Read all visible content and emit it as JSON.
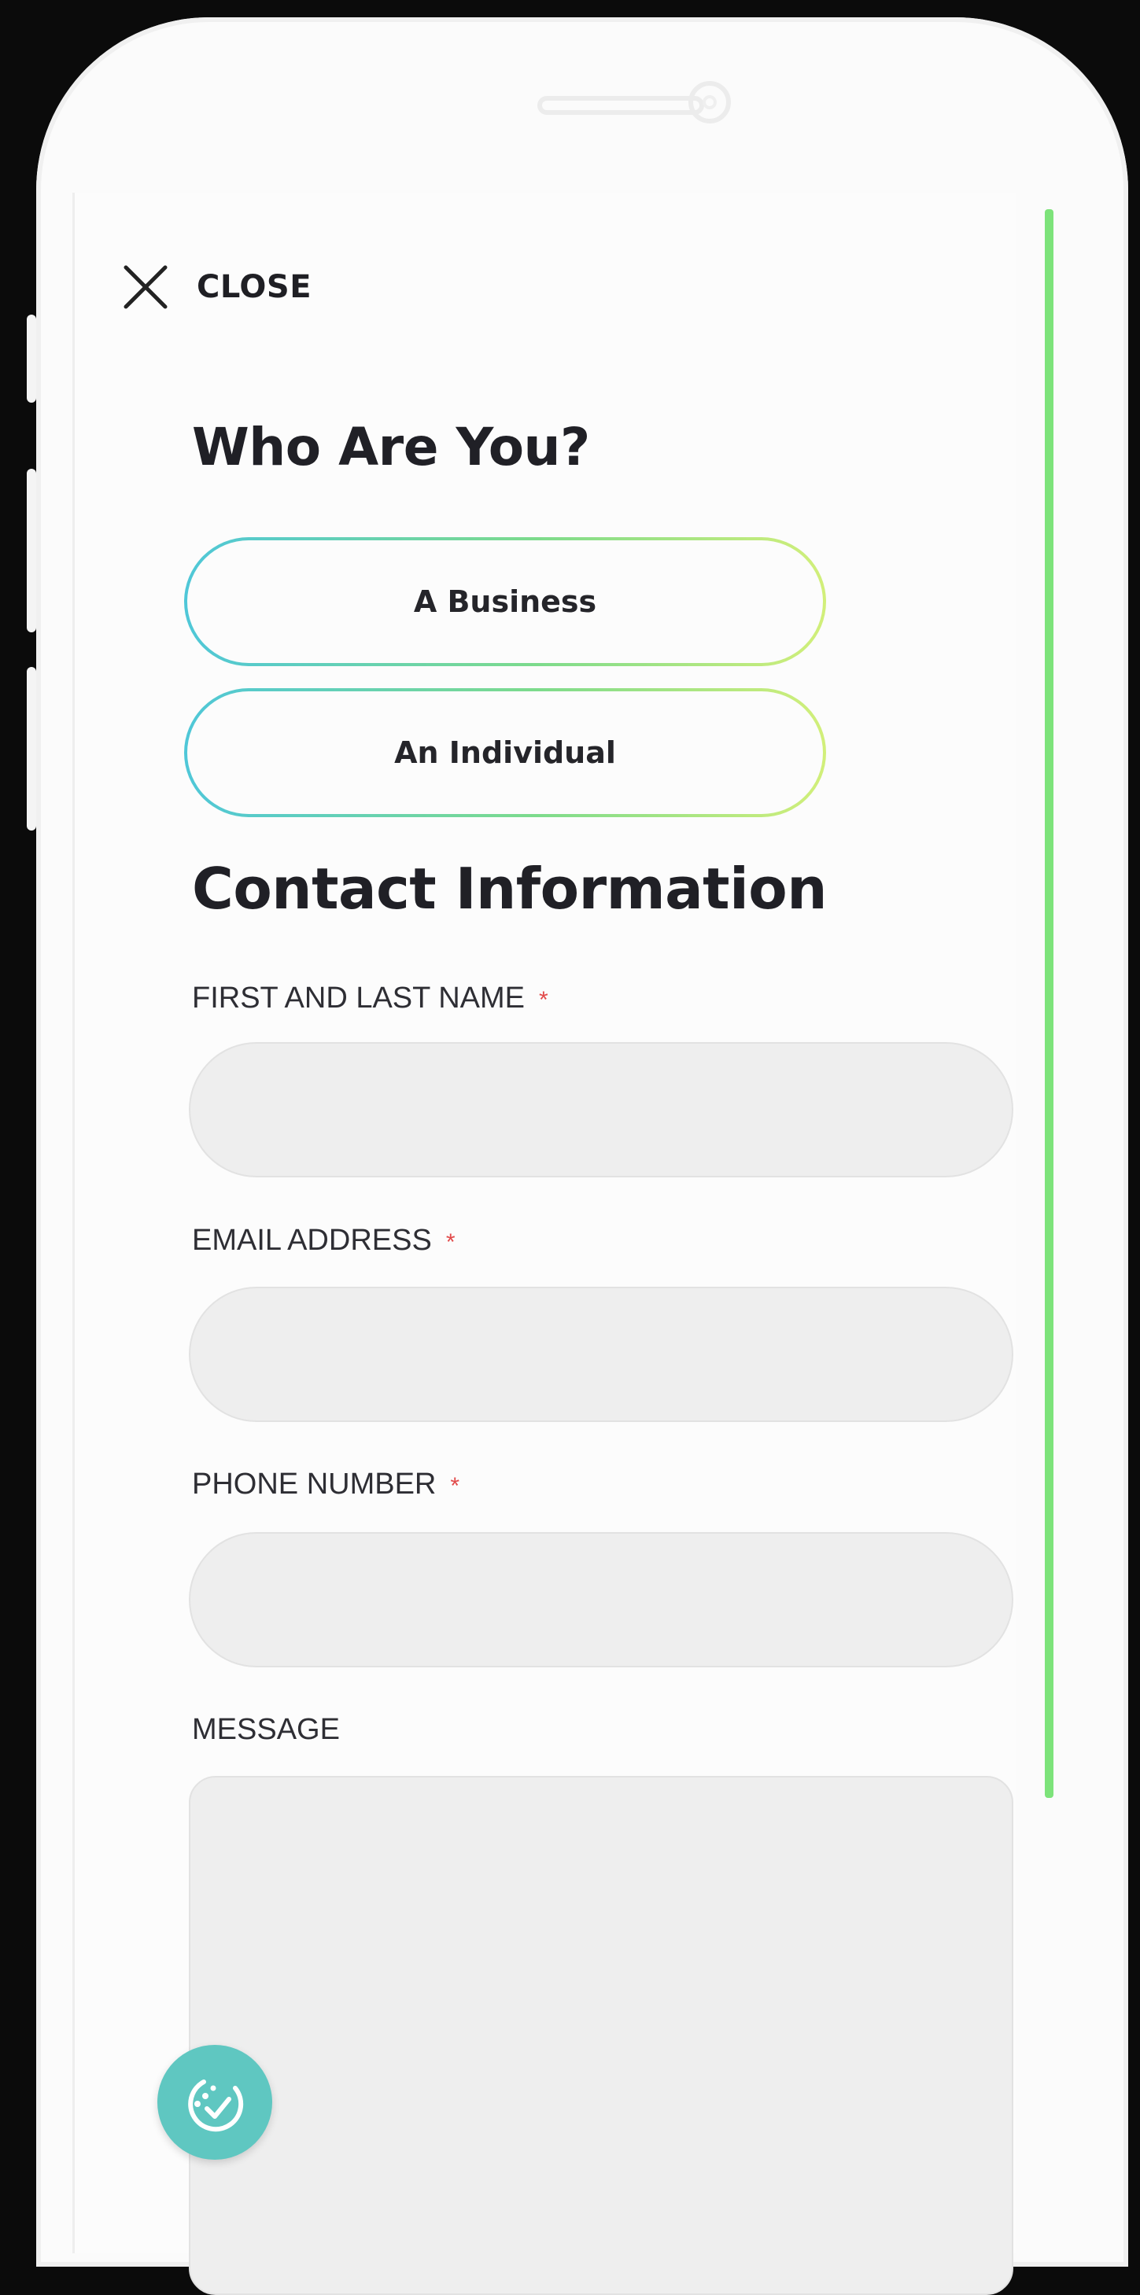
{
  "header": {
    "close_label": "CLOSE"
  },
  "who": {
    "heading": "Who Are You?",
    "options": [
      {
        "label": "A Business"
      },
      {
        "label": "An Individual"
      }
    ]
  },
  "contact": {
    "heading": "Contact Information",
    "fields": [
      {
        "label": "FIRST AND LAST NAME",
        "required_mark": "*",
        "value": ""
      },
      {
        "label": "EMAIL ADDRESS",
        "required_mark": "*",
        "value": ""
      },
      {
        "label": "PHONE NUMBER",
        "required_mark": "*",
        "value": ""
      }
    ],
    "message": {
      "label": "MESSAGE",
      "value": ""
    }
  },
  "icons": {
    "close": "close-icon",
    "fab": "clean-check-icon"
  },
  "colors": {
    "scrollbar": "#7de37a",
    "gradient_start": "#4fc7d8",
    "gradient_end": "#d2ef7a",
    "required": "#e24a4a",
    "fab": "#5fc7c1",
    "field_bg": "#eeeeee"
  }
}
